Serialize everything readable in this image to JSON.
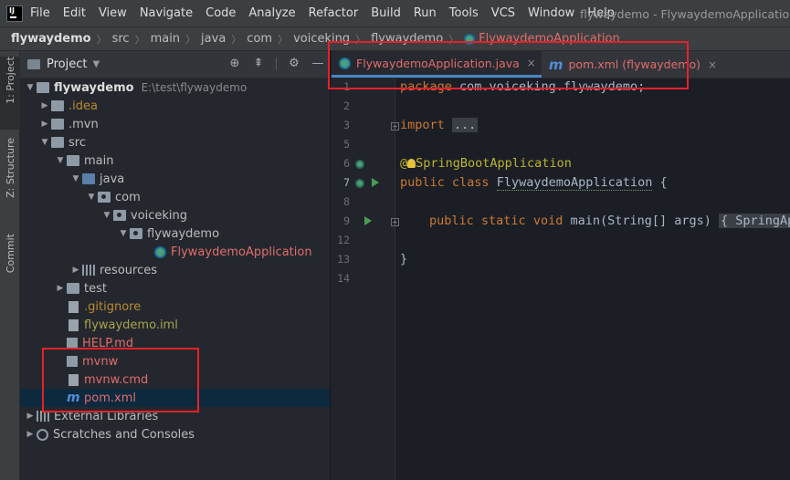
{
  "menubar": {
    "items": [
      "File",
      "Edit",
      "View",
      "Navigate",
      "Code",
      "Analyze",
      "Refactor",
      "Build",
      "Run",
      "Tools",
      "VCS",
      "Window",
      "Help"
    ],
    "window_title": "flywaydemo - FlywaydemoApplication.ja"
  },
  "breadcrumb": [
    "flywaydemo",
    "src",
    "main",
    "java",
    "com",
    "voiceking",
    "flywaydemo",
    "FlywaydemoApplication"
  ],
  "left_stripe": {
    "project": "1: Project",
    "structure": "Z: Structure",
    "commit": "Commit"
  },
  "project_panel": {
    "title": "Project",
    "tree": [
      {
        "label": "flywaydemo",
        "path": "E:\\test\\flywaydemo"
      },
      {
        "label": ".idea"
      },
      {
        "label": ".mvn"
      },
      {
        "label": "src"
      },
      {
        "label": "main"
      },
      {
        "label": "java"
      },
      {
        "label": "com"
      },
      {
        "label": "voiceking"
      },
      {
        "label": "flywaydemo"
      },
      {
        "label": "FlywaydemoApplication"
      },
      {
        "label": "resources"
      },
      {
        "label": "test"
      },
      {
        "label": ".gitignore"
      },
      {
        "label": "flywaydemo.iml"
      },
      {
        "label": "HELP.md"
      },
      {
        "label": "mvnw"
      },
      {
        "label": "mvnw.cmd"
      },
      {
        "label": "pom.xml"
      },
      {
        "label": "External Libraries"
      },
      {
        "label": "Scratches and Consoles"
      }
    ]
  },
  "editor_tabs": [
    {
      "label": "FlywaydemoApplication.java",
      "icon": "spring-class-icon"
    },
    {
      "label": "pom.xml (flywaydemo)",
      "icon": "maven-icon"
    }
  ],
  "editor": {
    "line_numbers": [
      "1",
      "2",
      "3",
      "5",
      "6",
      "7",
      "8",
      "9",
      "12",
      "13",
      "14"
    ],
    "lines": {
      "l1_kw": "package",
      "l1_rest": " com.voiceking.flywaydemo;",
      "l3_kw": "import",
      "l3_fold": "...",
      "l6_at": "@",
      "l6_ann": "SpringBootApplication",
      "l7_public": "public",
      "l7_class": " class ",
      "l7_name": "FlywaydemoApplication",
      "l7_brace": " {",
      "l9_public": "public",
      "l9_static": " static",
      "l9_void": " void",
      "l9_main": " main(String[] args)",
      "l9_fold": "{ SpringApp",
      "l13_brace": "}"
    }
  },
  "colors": {
    "highlight": "#e8202a",
    "selection": "#0d293e",
    "accent_tab": "#4a88c7"
  }
}
